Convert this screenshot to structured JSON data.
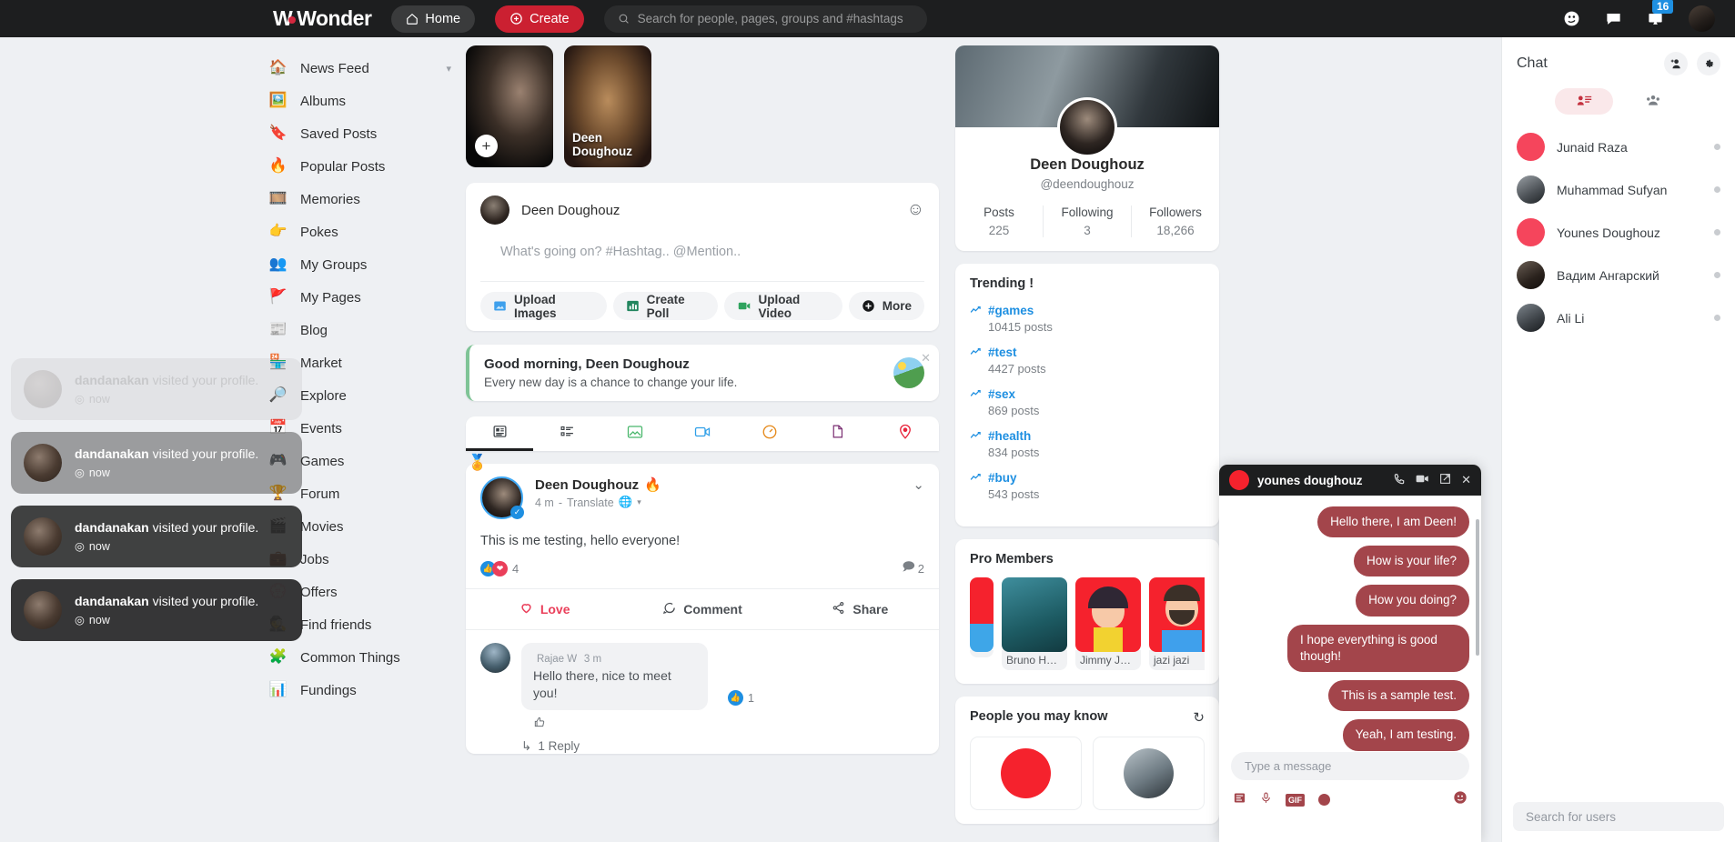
{
  "header": {
    "logo_text_1": "W",
    "logo_text_2": "Wonder",
    "home_label": "Home",
    "create_label": "Create",
    "search_placeholder": "Search for people, pages, groups and #hashtags",
    "notification_count": "16",
    "icons": [
      "friend-requests-icon",
      "messages-icon",
      "notifications-icon",
      "profile-avatar"
    ]
  },
  "sidebar": {
    "items": [
      {
        "label": "News Feed",
        "icon": "house-icon",
        "has_chevron": true
      },
      {
        "label": "Albums",
        "icon": "photo-album-icon",
        "has_chevron": false
      },
      {
        "label": "Saved Posts",
        "icon": "bookmark-icon",
        "has_chevron": false
      },
      {
        "label": "Popular Posts",
        "icon": "fire-icon",
        "has_chevron": false
      },
      {
        "label": "Memories",
        "icon": "memories-icon",
        "has_chevron": false
      },
      {
        "label": "Pokes",
        "icon": "pointing-hand-icon",
        "has_chevron": false
      },
      {
        "label": "My Groups",
        "icon": "people-group-icon",
        "has_chevron": false
      },
      {
        "label": "My Pages",
        "icon": "flag-icon",
        "has_chevron": false
      },
      {
        "label": "Blog",
        "icon": "newspaper-icon",
        "has_chevron": false
      },
      {
        "label": "Market",
        "icon": "store-icon",
        "has_chevron": false
      },
      {
        "label": "Explore",
        "icon": "magnifier-globe-icon",
        "has_chevron": false
      },
      {
        "label": "Events",
        "icon": "calendar-icon",
        "has_chevron": false
      },
      {
        "label": "Games",
        "icon": "gamepad-icon",
        "has_chevron": false
      },
      {
        "label": "Forum",
        "icon": "trophy-icon",
        "has_chevron": false
      },
      {
        "label": "Movies",
        "icon": "clapperboard-icon",
        "has_chevron": false
      },
      {
        "label": "Jobs",
        "icon": "briefcase-icon",
        "has_chevron": false
      },
      {
        "label": "Offers",
        "icon": "discount-icon",
        "has_chevron": false
      },
      {
        "label": "Find friends",
        "icon": "find-friends-icon",
        "has_chevron": false
      },
      {
        "label": "Common Things",
        "icon": "puzzle-icon",
        "has_chevron": false
      },
      {
        "label": "Fundings",
        "icon": "fundings-icon",
        "has_chevron": false
      }
    ]
  },
  "toasts": [
    {
      "user": "dandanakan",
      "text": "visited your profile.",
      "time": "now"
    },
    {
      "user": "dandanakan",
      "text": "visited your profile.",
      "time": "now"
    },
    {
      "user": "dandanakan",
      "text": "visited your profile.",
      "time": "now"
    },
    {
      "user": "dandanakan",
      "text": "visited your profile.",
      "time": "now"
    }
  ],
  "stories": [
    {
      "label": "",
      "add": "+"
    },
    {
      "label": "Deen Doughouz",
      "add": ""
    }
  ],
  "composer": {
    "user": "Deen Doughouz",
    "placeholder": "What's going on? #Hashtag.. @Mention..",
    "emoji_icon": "smiley-icon",
    "actions": [
      {
        "label": "Upload Images",
        "icon": "image-icon"
      },
      {
        "label": "Create Poll",
        "icon": "poll-icon"
      },
      {
        "label": "Upload Video",
        "icon": "video-icon"
      },
      {
        "label": "More",
        "icon": "plus-circle-icon"
      }
    ]
  },
  "greeting": {
    "title": "Good morning, Deen Doughouz",
    "subtitle": "Every new day is a chance to change your life.",
    "close_icon": "close-icon",
    "accent": "#7fc496"
  },
  "feed_tabs": [
    {
      "icon": "text-post-icon",
      "active": true
    },
    {
      "icon": "list-post-icon",
      "active": false
    },
    {
      "icon": "image-post-icon",
      "active": false
    },
    {
      "icon": "video-post-icon",
      "active": false
    },
    {
      "icon": "audio-post-icon",
      "active": false
    },
    {
      "icon": "file-post-icon",
      "active": false
    },
    {
      "icon": "location-post-icon",
      "active": false
    }
  ],
  "post": {
    "author": "Deen Doughouz",
    "author_badge_icon": "fire-badge-icon",
    "time": "4 m",
    "translate_label": "Translate",
    "privacy_icon": "globe-icon",
    "separator": "-",
    "text": "This is me testing, hello everyone!",
    "reaction_count": "4",
    "comment_count": "2",
    "verified_icon": "verified-check-icon",
    "award_icon": "award-ribbon-icon",
    "actions": [
      {
        "label": "Love",
        "icon": "heart-icon"
      },
      {
        "label": "Comment",
        "icon": "comment-icon"
      },
      {
        "label": "Share",
        "icon": "share-icon"
      }
    ],
    "comment": {
      "author": "Rajae W",
      "time": "3 m",
      "text": "Hello there, nice to meet you!",
      "like_count": "1",
      "like_icon": "thumbs-up-icon",
      "reply_label": "1 Reply",
      "reply_icon": "reply-arrow-icon"
    }
  },
  "profile": {
    "name": "Deen Doughouz",
    "username": "@deendoughouz",
    "stats": [
      {
        "label": "Posts",
        "value": "225"
      },
      {
        "label": "Following",
        "value": "3"
      },
      {
        "label": "Followers",
        "value": "18,266"
      }
    ]
  },
  "trending": {
    "title": "Trending !",
    "icon": "trend-up-icon",
    "items": [
      {
        "tag": "#games",
        "count": "10415 posts"
      },
      {
        "tag": "#test",
        "count": "4427 posts"
      },
      {
        "tag": "#sex",
        "count": "869 posts"
      },
      {
        "tag": "#health",
        "count": "834 posts"
      },
      {
        "tag": "#buy",
        "count": "543 posts"
      }
    ]
  },
  "pro_members": {
    "title": "Pro Members",
    "members": [
      {
        "name": ""
      },
      {
        "name": "Bruno Has..."
      },
      {
        "name": "Jimmy John"
      },
      {
        "name": "jazi jazi"
      }
    ]
  },
  "people_you_may_know": {
    "title": "People you may know",
    "refresh_icon": "refresh-icon"
  },
  "chat_sidebar": {
    "title": "Chat",
    "add_icon": "add-person-icon",
    "settings_icon": "gear-icon",
    "tabs": [
      {
        "icon": "contacts-list-icon",
        "active": true
      },
      {
        "icon": "group-people-icon",
        "active": false
      }
    ],
    "contacts": [
      {
        "name": "Junaid Raza",
        "color": "#f5455c"
      },
      {
        "name": "Muhammad Sufyan",
        "color": "#585c60"
      },
      {
        "name": "Younes Doughouz",
        "color": "#f5455c"
      },
      {
        "name": "Вадим Ангарский",
        "color": "#2d2b2b"
      },
      {
        "name": "Ali Li",
        "color": "#3a3f45"
      }
    ],
    "search_placeholder": "Search for users"
  },
  "chat_popup": {
    "name": "younes doughouz",
    "icons": [
      "phone-icon",
      "video-camera-icon",
      "open-external-icon",
      "close-icon"
    ],
    "bubble_color": "#a3454b",
    "messages": [
      "Hello there, I am Deen!",
      "How is your life?",
      "How you doing?",
      "I hope everything is good though!",
      "This is a sample test.",
      "Yeah, I am testing."
    ],
    "input_placeholder": "Type a message",
    "tools": [
      "sticker-icon",
      "microphone-icon",
      "gif-icon",
      "record-icon",
      "smiley-icon"
    ],
    "gif_label": "GIF"
  }
}
